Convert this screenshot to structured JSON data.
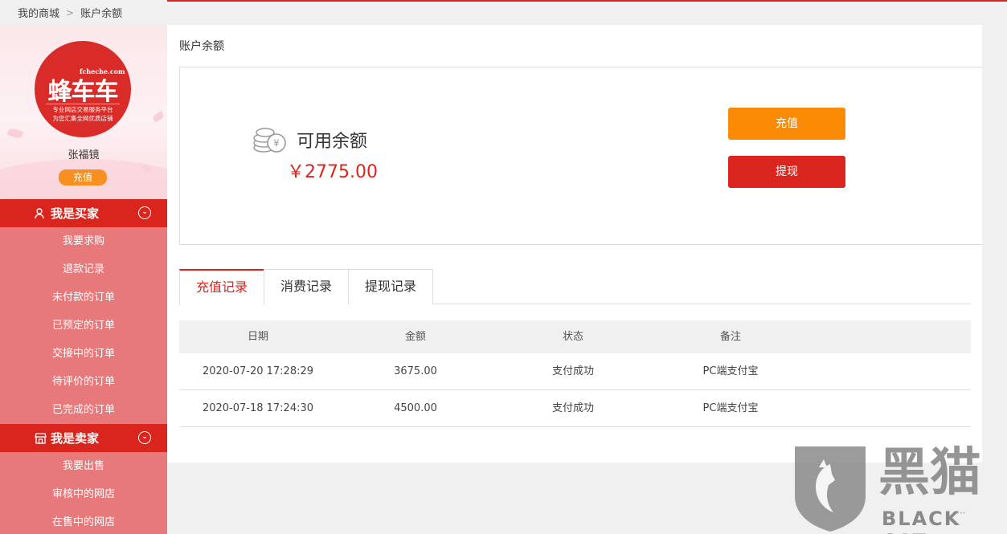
{
  "breadcrumb": {
    "home": "我的商城",
    "separator": ">",
    "current": "账户余额"
  },
  "sidebar": {
    "logo": {
      "domain": "fcheche.com",
      "brand": "蜂车车",
      "tagline1": "专业网店交易服务平台",
      "tagline2": "为您汇集全网优质店铺"
    },
    "username": "张福镜",
    "recharge_label": "充值",
    "buyer_section": {
      "title": "我是买家",
      "items": [
        "我要求购",
        "退款记录",
        "未付款的订单",
        "已预定的订单",
        "交接中的订单",
        "待评价的订单",
        "已完成的订单"
      ]
    },
    "seller_section": {
      "title": "我是卖家",
      "items": [
        "我要出售",
        "审核中的网店",
        "在售中的网店"
      ]
    }
  },
  "main": {
    "title": "账户余额",
    "balance": {
      "label": "可用余额",
      "amount": "￥2775.00"
    },
    "buttons": {
      "recharge": "充值",
      "withdraw": "提现"
    },
    "tabs": [
      {
        "label": "充值记录",
        "active": true
      },
      {
        "label": "消费记录",
        "active": false
      },
      {
        "label": "提现记录",
        "active": false
      }
    ],
    "table": {
      "headers": [
        "日期",
        "金额",
        "状态",
        "备注"
      ],
      "rows": [
        [
          "2020-07-20 17:28:29",
          "3675.00",
          "支付成功",
          "PC端支付宝"
        ],
        [
          "2020-07-18 17:24:30",
          "4500.00",
          "支付成功",
          "PC端支付宝"
        ]
      ]
    }
  },
  "watermark": {
    "cn": "黑猫",
    "en": "BLACK CAT"
  },
  "colors": {
    "brand_red": "#d9251d",
    "orange": "#fb8b05",
    "sidebar_bg": "#e8797b"
  }
}
